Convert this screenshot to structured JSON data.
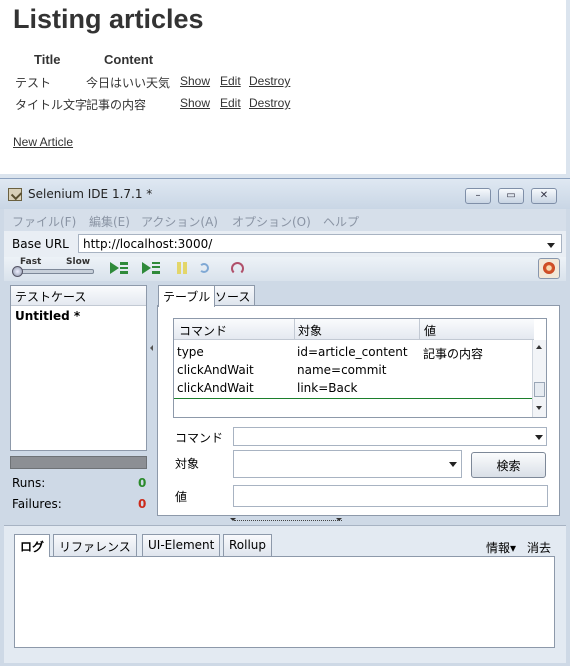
{
  "rails_page": {
    "heading": "Listing articles",
    "columns": [
      "Title",
      "Content"
    ],
    "rows": [
      {
        "title": "テスト",
        "content": "今日はいい天気",
        "show": "Show",
        "edit": "Edit",
        "destroy": "Destroy"
      },
      {
        "title": "タイトル文字",
        "content": "記事の内容",
        "show": "Show",
        "edit": "Edit",
        "destroy": "Destroy"
      }
    ],
    "new_link": "New Article"
  },
  "window": {
    "title": "Selenium IDE 1.7.1 *",
    "minimize": "–",
    "maximize": "▭",
    "close": "✕"
  },
  "menu": [
    "ファイル(F)",
    "編集(E)",
    "アクション(A)",
    "オプション(O)",
    "ヘルプ"
  ],
  "base_url": {
    "label": "Base URL",
    "value": "http://localhost:3000/"
  },
  "toolbar": {
    "fast": "Fast",
    "slow": "Slow"
  },
  "testcase_panel": {
    "header": "テストケース",
    "items": [
      "Untitled *"
    ]
  },
  "stats": {
    "runs_label": "Runs:",
    "runs": "0",
    "failures_label": "Failures:",
    "failures": "0"
  },
  "editor_tabs": [
    "テーブル",
    "ソース"
  ],
  "commands_table": {
    "headers": [
      "コマンド",
      "対象",
      "値"
    ],
    "rows": [
      {
        "command": "type",
        "target": "id=article_content",
        "value": "記事の内容"
      },
      {
        "command": "clickAndWait",
        "target": "name=commit",
        "value": ""
      },
      {
        "command": "clickAndWait",
        "target": "link=Back",
        "value": ""
      }
    ]
  },
  "form": {
    "command_label": "コマンド",
    "target_label": "対象",
    "value_label": "値",
    "find_button": "検索"
  },
  "log_tabs": [
    "ログ",
    "リファレンス",
    "UI-Element",
    "Rollup"
  ],
  "log_actions": {
    "info": "情報▾",
    "clear": "消去"
  },
  "colors": {
    "runs": "#2a8a2a",
    "failures": "#cc2a1a",
    "link": "#666666"
  }
}
